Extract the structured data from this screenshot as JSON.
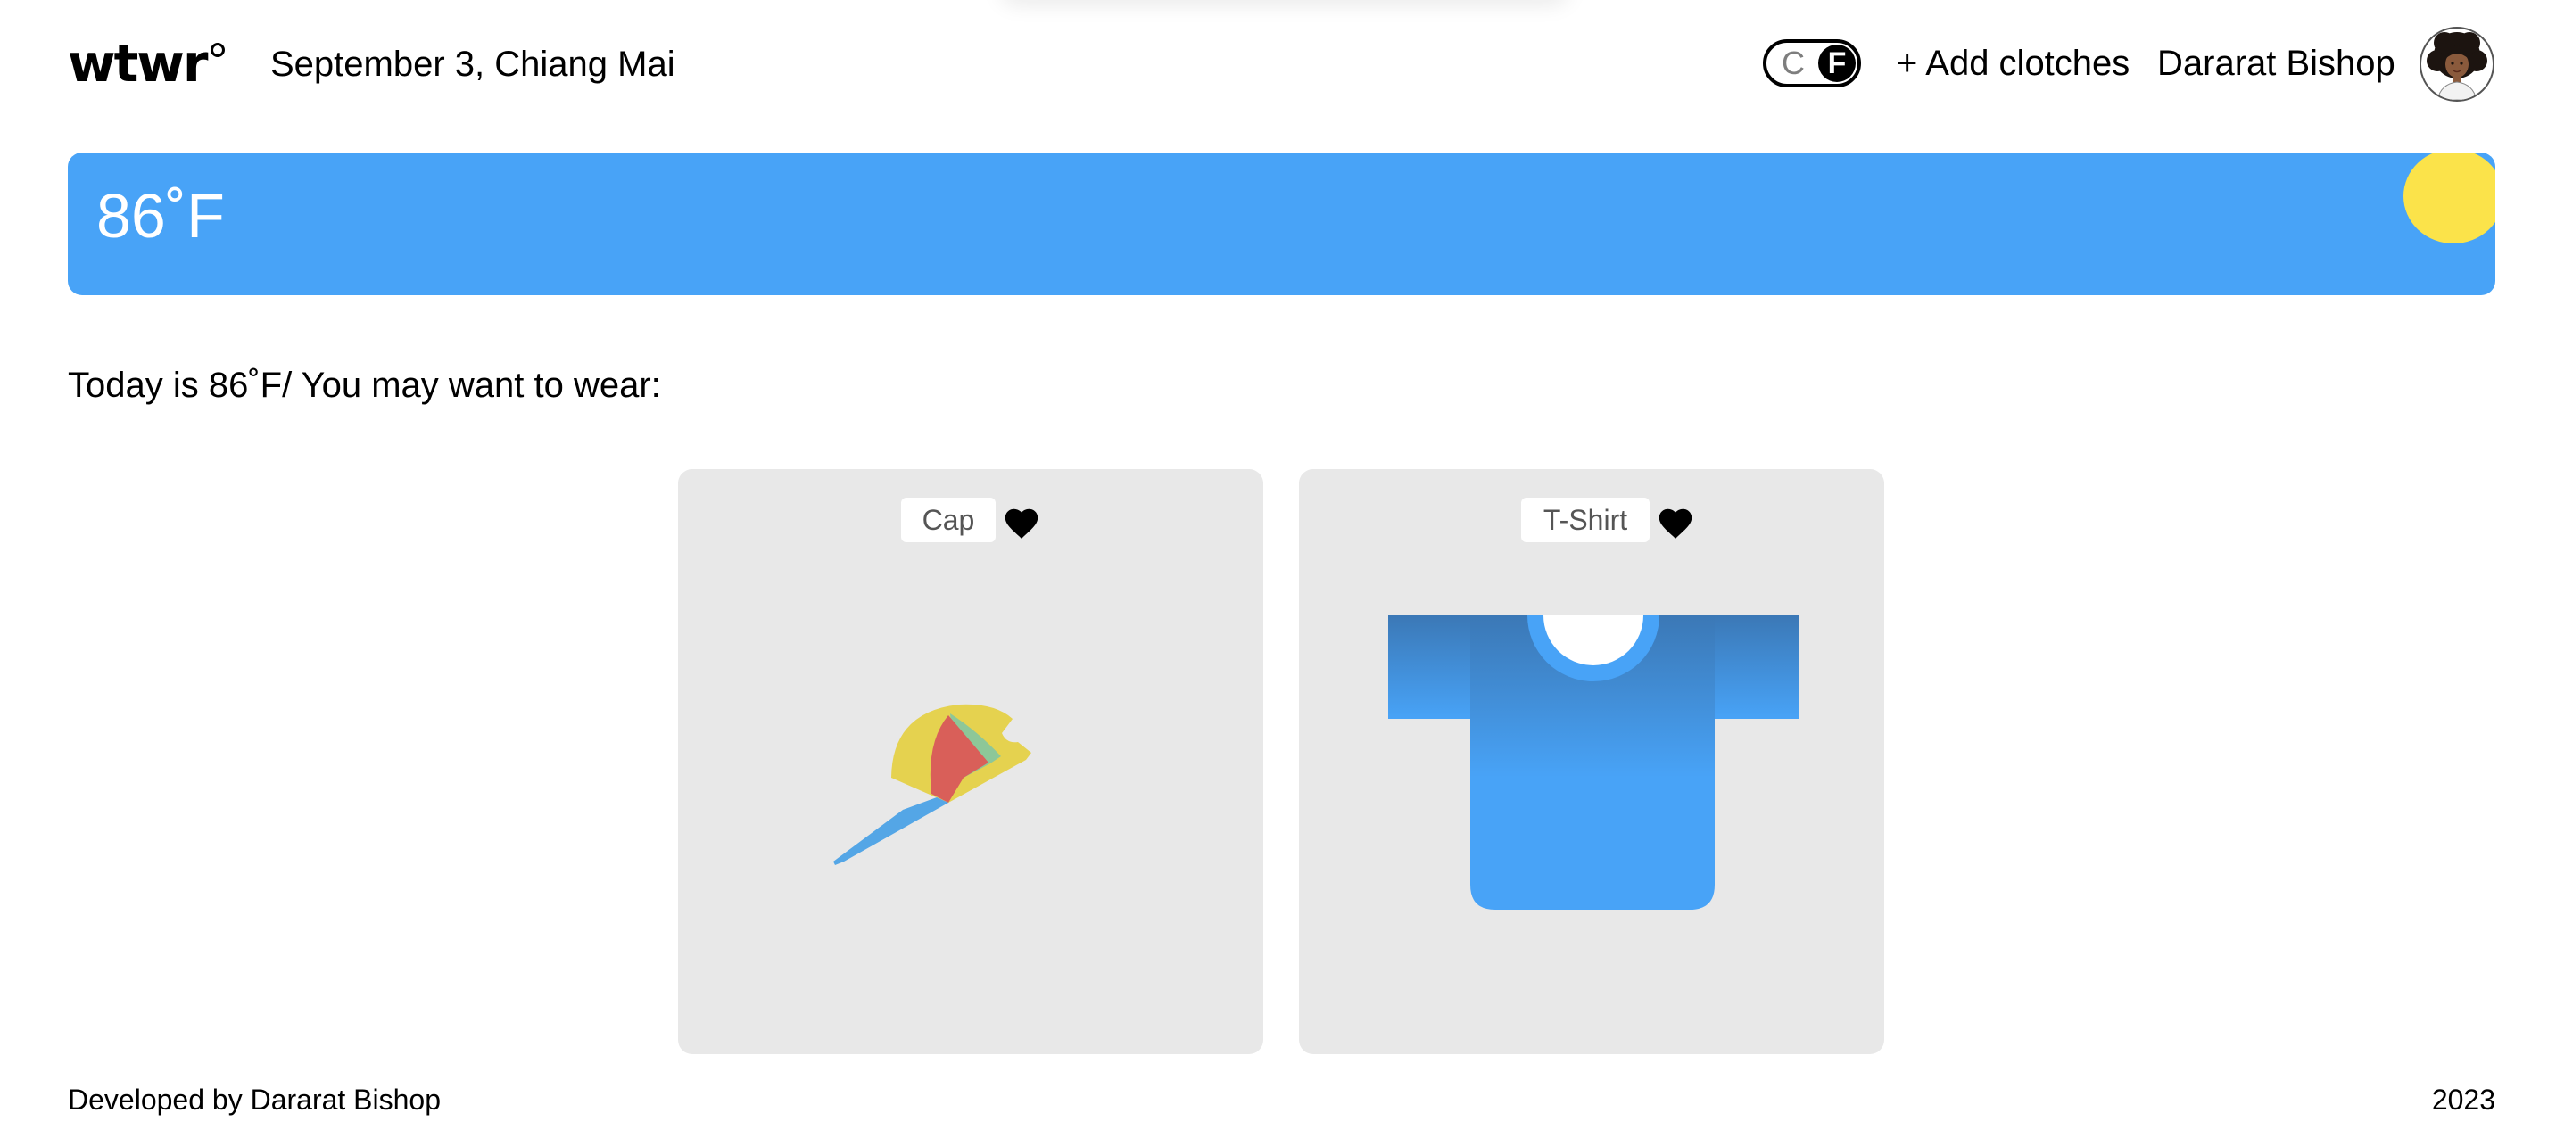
{
  "header": {
    "logo_text": "wtwr",
    "date_location": "September 3, Chiang Mai",
    "unit_toggle": {
      "off_label": "C",
      "on_label": "F",
      "selected": "F"
    },
    "add_clothes_label": "+ Add clotches",
    "user_name": "Dararat Bishop",
    "avatar_icon": "user-avatar"
  },
  "weather": {
    "temperature": "86˚F",
    "condition_icon": "sun-icon",
    "bar_color": "#48a3f7",
    "sun_color": "#fbe34a"
  },
  "main": {
    "recommendation_text": "Today is 86˚F/ You may want to wear:",
    "cards": [
      {
        "name": "Cap",
        "like_icon": "heart-icon",
        "image_icon": "cap-icon"
      },
      {
        "name": "T-Shirt",
        "like_icon": "heart-icon",
        "image_icon": "t-shirt-icon"
      }
    ]
  },
  "footer": {
    "developer_text": "Developed by Dararat Bishop",
    "year": "2023"
  }
}
